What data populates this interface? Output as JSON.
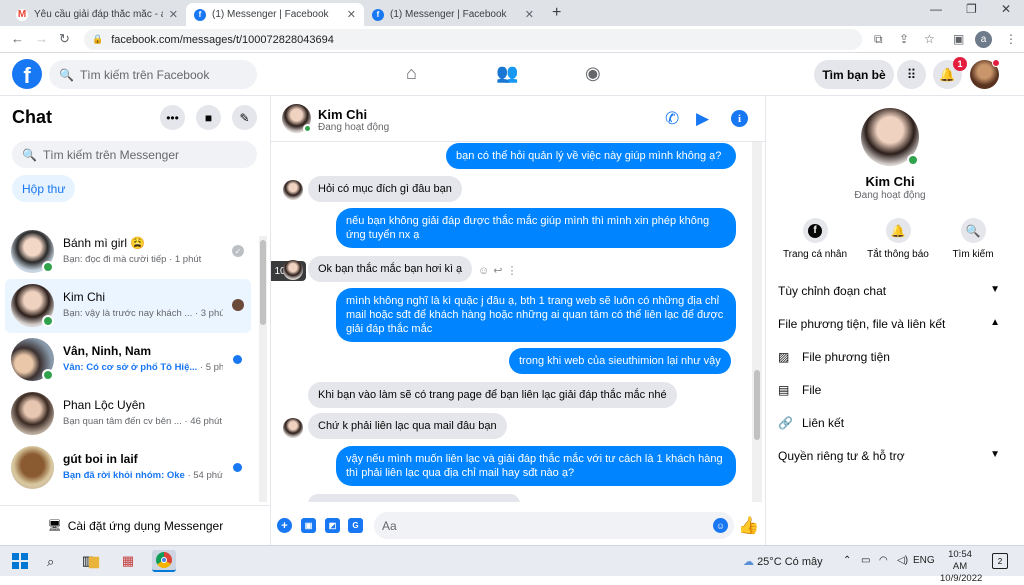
{
  "browser": {
    "tabs": [
      {
        "title": "Yêu cầu giải đáp thắc mắc - anht",
        "favicon": "gmail-icon",
        "active": false
      },
      {
        "title": "(1) Messenger | Facebook",
        "favicon": "facebook-icon",
        "active": true
      },
      {
        "title": "(1) Messenger | Facebook",
        "favicon": "facebook-icon",
        "active": false
      }
    ],
    "url": "facebook.com/messages/t/100072828043694",
    "profile_initial": "a"
  },
  "fb_header": {
    "search_placeholder": "Tìm kiếm trên Facebook",
    "find_friends": "Tìm bạn bè",
    "notif_count": "1"
  },
  "chat_list": {
    "title": "Chat",
    "search_placeholder": "Tìm kiếm trên Messenger",
    "inbox_chip": "Hộp thư",
    "install_label": "Cài đặt ứng dụng Messenger",
    "conversations": [
      {
        "name": "Bánh mì girl 😩",
        "preview": "Bạn: đọc đi mà cười tiếp",
        "time": "· 1 phút",
        "unread": false,
        "online": true,
        "status": "seen"
      },
      {
        "name": "Kim Chi",
        "preview": "Bạn: vậy là trước nay khách ...",
        "time": "· 3 phút",
        "unread": false,
        "online": true,
        "status": "seen-avatar",
        "selected": true
      },
      {
        "name": "Vân, Ninh, Nam",
        "preview": "Vân: Có cơ sở ở phố Tô Hiệ...",
        "time": "· 5 phút",
        "unread": true,
        "online": true,
        "status": "unread"
      },
      {
        "name": "Phan Lộc Uyên",
        "preview": "Bạn quan tâm đến cv bên ...",
        "time": "· 46 phút",
        "unread": false,
        "online": false,
        "status": "none"
      },
      {
        "name": "gút boi in laif",
        "preview": "Bạn đã rời khỏi nhóm: Oke",
        "time": "· 54 phút",
        "unread": true,
        "online": false,
        "status": "unread"
      }
    ]
  },
  "conversation": {
    "name": "Kim Chi",
    "status": "Đang hoạt động",
    "hover_time": "10:45",
    "composer_placeholder": "Aa",
    "messages": [
      {
        "dir": "out",
        "text": "bạn có thể hỏi quản lý về việc này giúp mình không ạ?"
      },
      {
        "dir": "in",
        "text": "Hỏi có mục đích gì đâu bạn"
      },
      {
        "dir": "out",
        "text": "nếu bạn không giải đáp được thắc mắc giúp mình thì mình xin phép không ứng tuyển nx ạ"
      },
      {
        "dir": "in",
        "text": "Ok bạn thắc mắc bạn hơi kì ạ"
      },
      {
        "dir": "out",
        "text": "mình không nghĩ là kì quặc j đâu ạ, bth 1 trang web sẽ luôn có những địa chỉ mail hoặc sđt để khách hàng hoặc những ai quan tâm có thể liên lạc để được giải đáp thắc mắc"
      },
      {
        "dir": "out",
        "text": "trong khi web của sieuthimion lại như vậy"
      },
      {
        "dir": "in",
        "text": "Khi bạn vào làm sẽ có trang page để bạn liên lạc giải đáp thắc mắc nhé"
      },
      {
        "dir": "in",
        "text": "Chứ k phải liên lạc qua mail đâu bạn"
      },
      {
        "dir": "out",
        "text": "vậy nếu mình muốn liên lạc và giải đáp thắc mắc với tư cách là 1 khách hàng thì phải liên lạc qua địa chỉ mail hay sđt nào ạ?"
      }
    ]
  },
  "info_pane": {
    "name": "Kim Chi",
    "status": "Đang hoạt động",
    "actions": [
      {
        "label": "Trang cá nhân",
        "icon": "facebook-icon"
      },
      {
        "label": "Tắt thông báo",
        "icon": "bell-icon"
      },
      {
        "label": "Tìm kiếm",
        "icon": "search-icon"
      }
    ],
    "sections": {
      "customize": "Tùy chỉnh đoạn chat",
      "media": "File phương tiện, file và liên kết",
      "media_items": [
        "File phương tiện",
        "File",
        "Liên kết"
      ],
      "privacy": "Quyền riêng tư & hỗ trợ"
    }
  },
  "taskbar": {
    "weather": "25°C Có mây",
    "lang": "ENG",
    "time": "10:54 AM",
    "date": "10/9/2022",
    "notif_count": "2"
  },
  "colors": {
    "brand": "#1877f2",
    "bubble_out": "#0084ff",
    "bubble_in": "#e4e6eb",
    "online": "#31a24c"
  }
}
